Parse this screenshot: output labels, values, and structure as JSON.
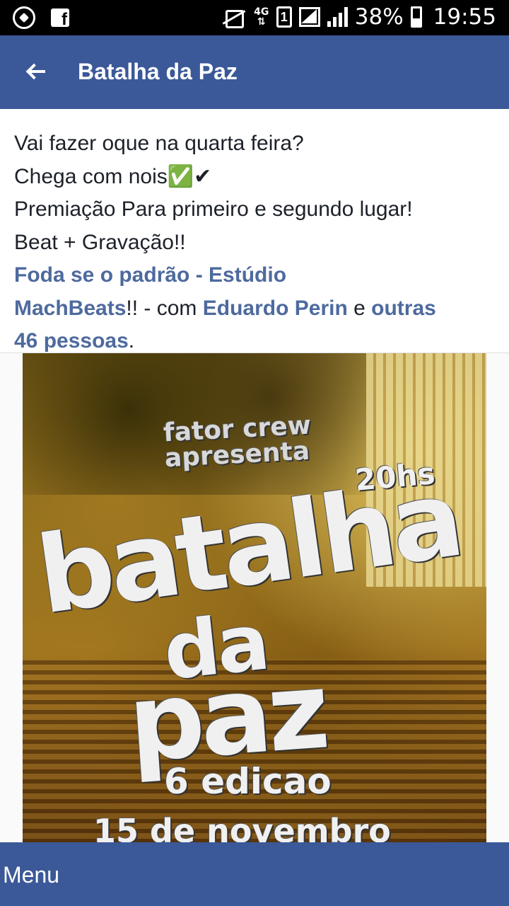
{
  "status_bar": {
    "battery_percent": "38%",
    "time": "19:55",
    "network_label": "4G",
    "sim_label": "1",
    "icons": [
      "whatsapp-icon",
      "facebook-icon",
      "mute-vibrate-icon",
      "4g-icon",
      "sim-icon",
      "signal-icon",
      "signal-bars-icon",
      "battery-icon"
    ]
  },
  "header": {
    "title": "Batalha da Paz",
    "back_icon": "back-arrow-icon"
  },
  "post": {
    "line1": "Vai fazer oque na quarta feira?",
    "line2": "Chega com nois✅✔",
    "line3": "Premiação Para primeiro e segundo lugar!",
    "line4": "Beat + Gravação!!",
    "link_place_a": "Foda se o padrão - Estúdio",
    "link_place_b": "MachBeats",
    "after_place": "!! - com ",
    "link_person": "Eduardo Perin",
    "conj": " e ",
    "link_others_a": "outras",
    "link_others_b": "46 pessoas",
    "period": "."
  },
  "poster": {
    "crew_line1": "fator crew",
    "crew_line2": "apresenta",
    "time": "20hs",
    "title_1": "batalha",
    "title_2": "da",
    "title_3": "paz",
    "edition": "6 edicao",
    "date": "15 de novembro"
  },
  "bottom_bar": {
    "menu_label": "Menu"
  },
  "colors": {
    "brand_blue": "#3b5998",
    "link_blue": "#4e6a9e",
    "text": "#1d2129"
  }
}
